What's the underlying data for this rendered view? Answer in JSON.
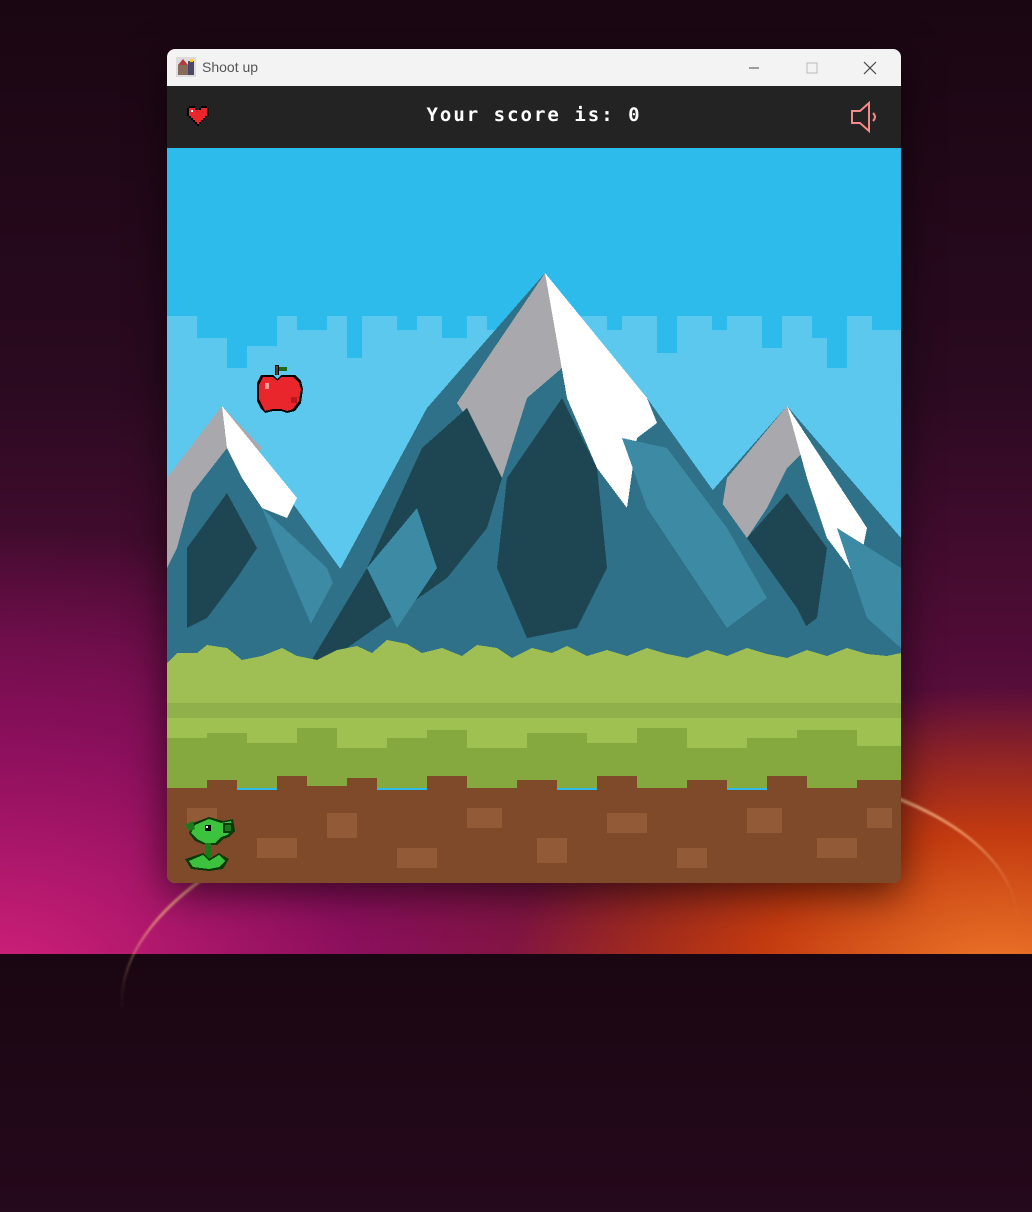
{
  "window": {
    "title": "Shoot up"
  },
  "hud": {
    "score_text": "Your score is: 0",
    "lives": 1
  },
  "icons": {
    "app": "app-icon",
    "minimize": "minimize-icon",
    "maximize": "maximize-icon",
    "close": "close-icon",
    "life": "heart-icon",
    "sound": "speaker-icon"
  },
  "colors": {
    "sky": "#2dbbeb",
    "hud_bg": "#232323",
    "score_text": "#ffffff",
    "heart": "#e8262b"
  }
}
